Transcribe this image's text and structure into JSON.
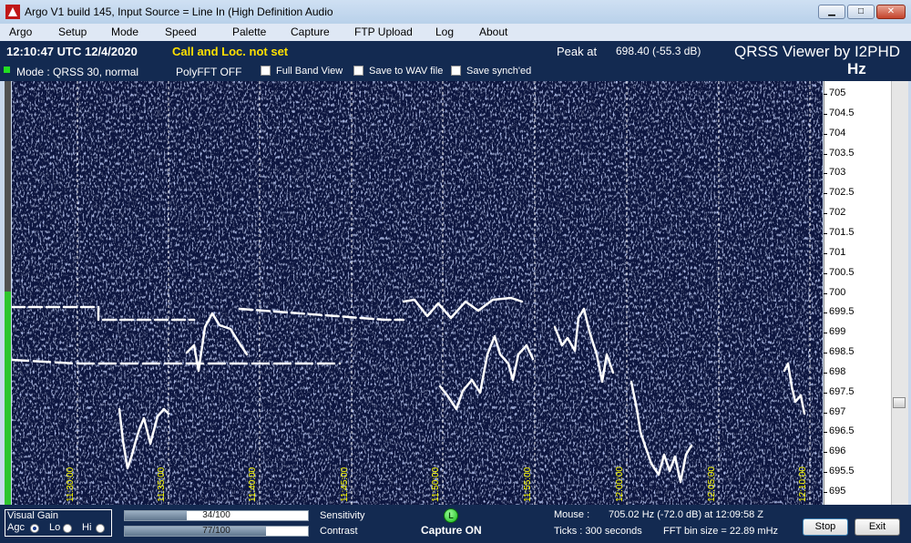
{
  "window": {
    "title": "Argo V1 build 145, Input Source = Line In (High Definition Audio",
    "min_glyph": "▁",
    "max_glyph": "□",
    "close_glyph": "✕"
  },
  "menu": [
    "Argo",
    "Setup",
    "Mode",
    "Speed",
    "Palette",
    "Capture",
    "FTP Upload",
    "Log",
    "About"
  ],
  "info": {
    "clock": "12:10:47 UTC  12/4/2020",
    "call_warning": "Call and Loc. not set",
    "peak_label": "Peak at",
    "peak_value": "698.40 (-55.3 dB)",
    "brand": "QRSS Viewer by I2PHD",
    "unit": "Hz",
    "mode": "Mode : QRSS 30, normal",
    "polyfft": "PolyFFT OFF",
    "checkboxes": [
      "Full Band View",
      "Save to WAV file",
      "Save synch'ed"
    ]
  },
  "scale_labels": [
    "705",
    "704.5",
    "704",
    "703.5",
    "703",
    "702.5",
    "702",
    "701.5",
    "701",
    "700.5",
    "700",
    "699.5",
    "699",
    "698.5",
    "698",
    "697.5",
    "697",
    "696.5",
    "696",
    "695.5",
    "695"
  ],
  "time_labels": [
    "11:30:00",
    "11:35:00",
    "11:40:00",
    "11:45:00",
    "11:50:00",
    "11:55:00",
    "12:00:00",
    "12:05:00",
    "12:10:00"
  ],
  "status": {
    "gain_title": "Visual Gain",
    "gain_options": [
      "Agc",
      "Lo",
      "Hi"
    ],
    "gain_selected": "Agc",
    "sensitivity_value": "34/100",
    "sensitivity_fraction": 0.34,
    "sensitivity_label": "Sensitivity",
    "contrast_value": "77/100",
    "contrast_fraction": 0.77,
    "contrast_label": "Contrast",
    "capture_led": "L",
    "capture": "Capture ON",
    "mouse_label": "Mouse :",
    "mouse_value": "705.02 Hz  (-72.0 dB) at 12:09:58 Z",
    "ticks": "Ticks  : 300 seconds",
    "fft_bin": "FFT bin size = 22.89 mHz",
    "stop": "Stop",
    "exit": "Exit"
  },
  "colors": {
    "panel": "#132a51",
    "waterfall_bg": "#0b1640",
    "trace": "#ffffff",
    "warning": "#ffe000"
  }
}
